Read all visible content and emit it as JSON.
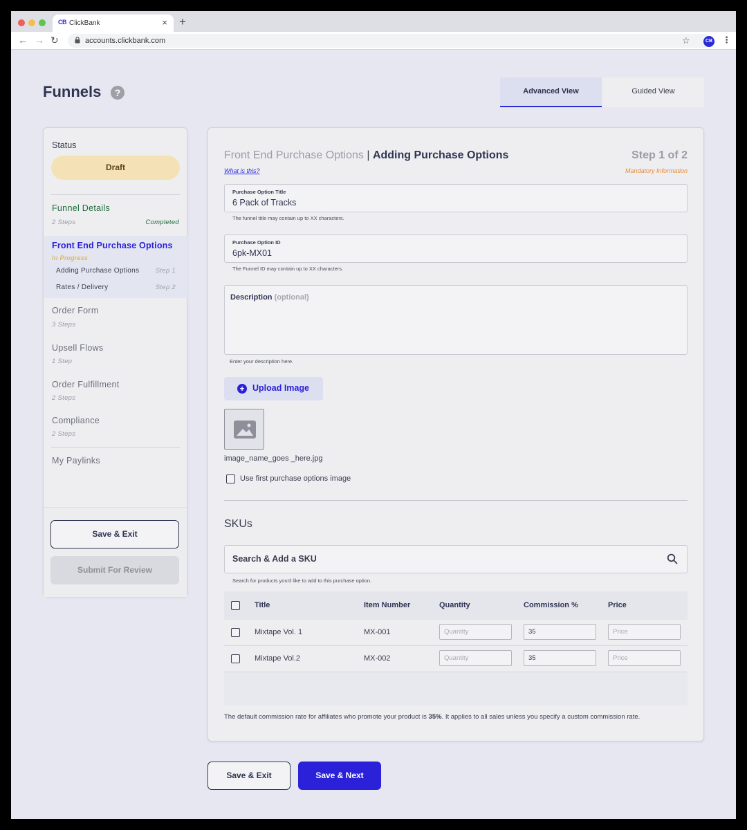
{
  "browser": {
    "tab_favicon": "CB",
    "tab_title": "ClickBank",
    "tab_close": "×",
    "new_tab": "+",
    "url": "accounts.clickbank.com",
    "profile_initials": "CB",
    "back_icon": "←",
    "forward_icon": "→",
    "reload_icon": "↻",
    "star_icon": "☆",
    "menu_icon": "⋮",
    "lock_icon": "🔒"
  },
  "header": {
    "title": "Funnels",
    "help": "?",
    "views": [
      "Advanced View",
      "Guided View"
    ],
    "active_view": "Advanced View"
  },
  "sidebar": {
    "status_label": "Status",
    "status_value": "Draft",
    "sections": [
      {
        "title": "Funnel Details",
        "sub": "2 Steps",
        "badge": "Completed",
        "state": "completed"
      },
      {
        "title": "Front End Purchase Options",
        "sub": "In Progress",
        "state": "active",
        "steps": [
          {
            "label": "Adding Purchase Options",
            "step": "Step 1"
          },
          {
            "label": "Rates / Delivery",
            "step": "Step 2"
          }
        ]
      },
      {
        "title": "Order Form",
        "sub": "3 Steps"
      },
      {
        "title": "Upsell Flows",
        "sub": "1 Step"
      },
      {
        "title": "Order Fulfillment",
        "sub": "2 Steps"
      },
      {
        "title": "Compliance",
        "sub": "2 Steps"
      },
      {
        "title": "My Paylinks",
        "sub": ""
      }
    ],
    "save_exit": "Save & Exit",
    "submit_review": "Submit For Review"
  },
  "panel": {
    "title_section": "Front End Purchase Options",
    "title_sep": " | ",
    "title_step": "Adding Purchase Options",
    "step_indicator": "Step 1 of 2",
    "what_is_this": "What is this?",
    "mandatory": "Mandatory Information",
    "option_title": {
      "label": "Purchase Option Title",
      "value": "6 Pack of Tracks",
      "hint": "The funnel title may contain up to XX characters."
    },
    "option_id": {
      "label": "Purchase Option ID",
      "value": "6pk-MX01",
      "hint": "The Funnel ID may contain up to XX characters."
    },
    "description": {
      "label": "Description",
      "optional": "(optional)",
      "hint": "Enter your description here."
    },
    "upload_label": "Upload Image",
    "image_name": "image_name_goes _here.jpg",
    "use_first_image": "Use first purchase options image",
    "skus_title": "SKUs",
    "sku_search": {
      "placeholder": "Search & Add a SKU",
      "hint": "Search for products you'd like to add to this purchase option."
    },
    "table": {
      "columns": [
        "Title",
        "Item Number",
        "Quantity",
        "Commission %",
        "Price"
      ],
      "rows": [
        {
          "title": "Mixtape Vol. 1",
          "item": "MX-001",
          "quantity_placeholder": "Quantity",
          "commission": "35",
          "price_placeholder": "Price"
        },
        {
          "title": "Mixtape Vol.2",
          "item": "MX-002",
          "quantity_placeholder": "Quantity",
          "commission": "35",
          "price_placeholder": "Price"
        }
      ]
    },
    "note_before": "The default commission rate for affiliates who promote your product is ",
    "note_rate": "35%",
    "note_after": ". It applies to all sales unless you specify a custom commission rate."
  },
  "footer": {
    "save_exit": "Save & Exit",
    "save_next": "Save & Next"
  },
  "colors": {
    "accent": "#2b21d9",
    "completed": "#1f6b3a",
    "in_progress": "#e0a526",
    "mandatory": "#ea8a2e",
    "draft_bg": "#f4e2b6"
  }
}
